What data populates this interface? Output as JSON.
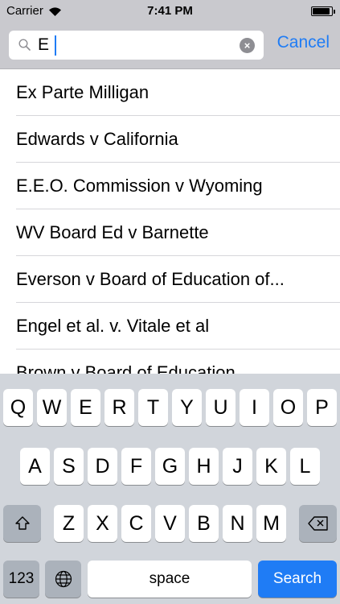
{
  "status": {
    "carrier": "Carrier",
    "time": "7:41 PM",
    "battery_level": 0.9
  },
  "search": {
    "query": "E",
    "cancel_label": "Cancel",
    "clear_icon": "×"
  },
  "results": [
    "Ex Parte Milligan",
    "Edwards v California",
    "E.E.O. Commission v Wyoming",
    "WV Board Ed v Barnette",
    "Everson v Board of Education of...",
    "Engel et al. v. Vitale et al",
    "Brown v Board of Education"
  ],
  "keyboard": {
    "row1": [
      "Q",
      "W",
      "E",
      "R",
      "T",
      "Y",
      "U",
      "I",
      "O",
      "P"
    ],
    "row2": [
      "A",
      "S",
      "D",
      "F",
      "G",
      "H",
      "J",
      "K",
      "L"
    ],
    "row3": [
      "Z",
      "X",
      "C",
      "V",
      "B",
      "N",
      "M"
    ],
    "numbers_label": "123",
    "space_label": "space",
    "search_label": "Search",
    "icons": {
      "shift": "shift-icon",
      "delete": "backspace-icon",
      "globe": "globe-icon"
    }
  }
}
